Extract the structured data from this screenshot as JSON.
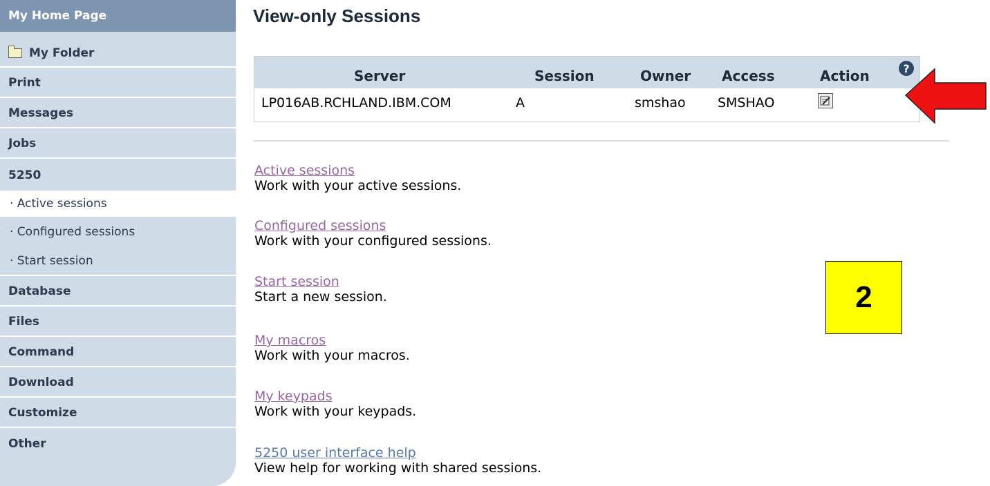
{
  "sidebar": {
    "home": "My Home Page",
    "folder": "My Folder",
    "items": [
      "Print",
      "Messages",
      "Jobs",
      "5250"
    ],
    "sub_items": [
      "· Active sessions",
      "· Configured sessions",
      "· Start session"
    ],
    "items_after": [
      "Database",
      "Files",
      "Command",
      "Download",
      "Customize",
      "Other"
    ]
  },
  "main": {
    "title": "View-only Sessions",
    "table": {
      "headers": [
        "Server",
        "Session",
        "Owner",
        "Access",
        "Action"
      ],
      "row": [
        "LP016AB.RCHLAND.IBM.COM",
        "A",
        "smshao",
        "SMSHAO"
      ],
      "help_icon_text": "?"
    },
    "links": [
      {
        "link": "Active sessions",
        "desc": "Work with your active sessions."
      },
      {
        "link": "Configured sessions",
        "desc": "Work with your configured sessions."
      },
      {
        "link": "Start session",
        "desc": "Start a new session."
      },
      {
        "link": "My macros",
        "desc": "Work with your macros."
      },
      {
        "link": "My keypads",
        "desc": "Work with your keypads."
      },
      {
        "link": "5250 user interface help",
        "desc": "View help for working with shared sessions."
      }
    ]
  },
  "callout": {
    "label": "2"
  },
  "colors": {
    "accent_arrow": "#ee1111",
    "callout_bg": "#ffff00",
    "sidebar_bg": "#cfdbe6",
    "visited_link": "#9b65a3"
  },
  "icons": {
    "folder": "folder-icon",
    "help": "help-icon",
    "action": "view-session-icon",
    "arrow": "arrow-left-icon"
  }
}
